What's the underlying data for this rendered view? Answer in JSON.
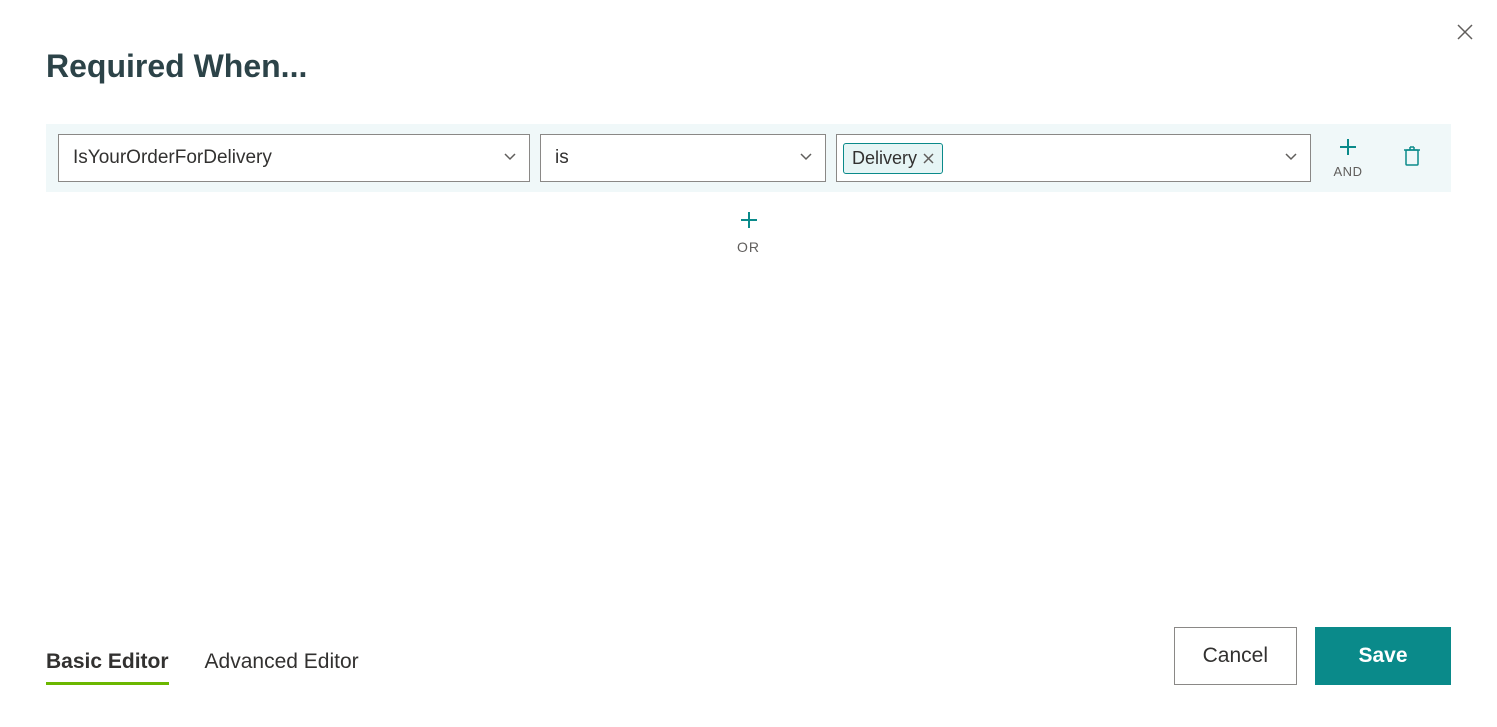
{
  "dialog": {
    "title": "Required When..."
  },
  "rule": {
    "field": "IsYourOrderForDelivery",
    "operator": "is",
    "value_tag": "Delivery",
    "and_label": "AND",
    "or_label": "OR"
  },
  "tabs": {
    "basic": "Basic Editor",
    "advanced": "Advanced Editor"
  },
  "buttons": {
    "cancel": "Cancel",
    "save": "Save"
  }
}
